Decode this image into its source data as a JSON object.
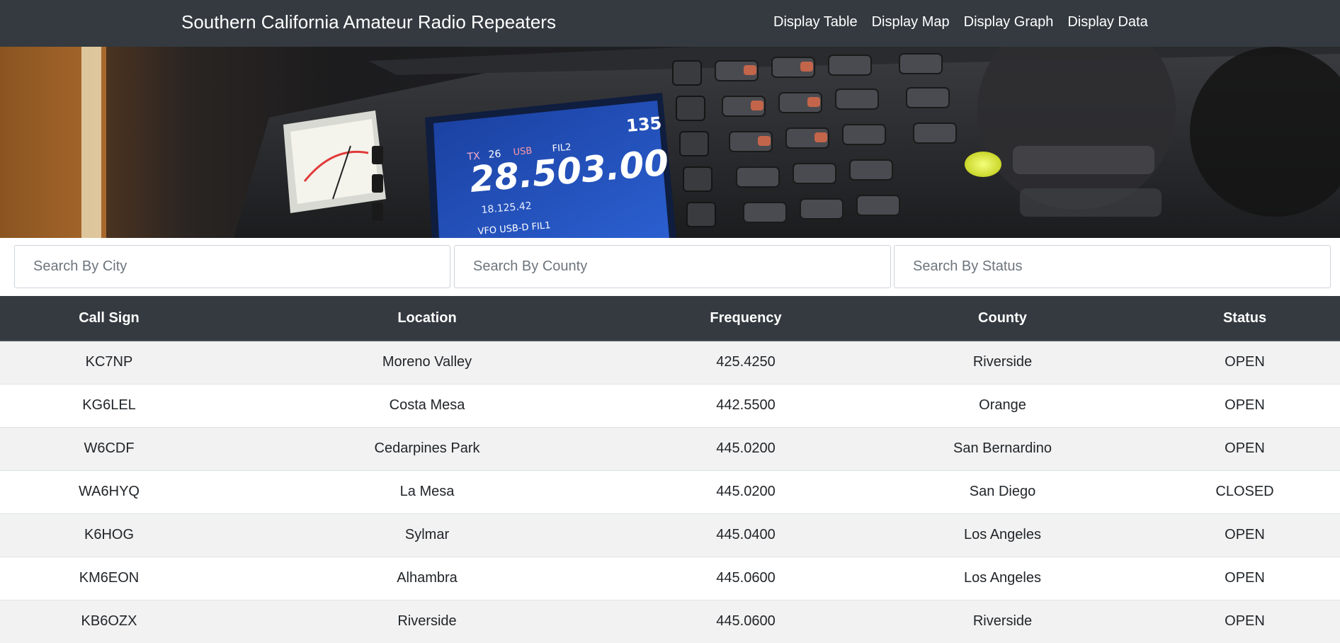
{
  "navbar": {
    "brand": "Southern California Amateur Radio Repeaters",
    "links": [
      "Display Table",
      "Display Map",
      "Display Graph",
      "Display Data"
    ]
  },
  "hero": {
    "description": "photo of amateur radio transceiver",
    "display_frequency": "28.503.00",
    "display_vfo": "18.125.42",
    "display_mode_left": "USB",
    "display_fil": "FIL2",
    "display_channel": "26",
    "display_tx": "TX",
    "display_bottom": "VFO  USB-D   FIL1",
    "display_right": "135"
  },
  "search": {
    "city_placeholder": "Search By City",
    "county_placeholder": "Search By County",
    "status_placeholder": "Search By Status"
  },
  "table": {
    "headers": [
      "Call Sign",
      "Location",
      "Frequency",
      "County",
      "Status"
    ],
    "rows": [
      [
        "KC7NP",
        "Moreno Valley",
        "425.4250",
        "Riverside",
        "OPEN"
      ],
      [
        "KG6LEL",
        "Costa Mesa",
        "442.5500",
        "Orange",
        "OPEN"
      ],
      [
        "W6CDF",
        "Cedarpines Park",
        "445.0200",
        "San Bernardino",
        "OPEN"
      ],
      [
        "WA6HYQ",
        "La Mesa",
        "445.0200",
        "San Diego",
        "CLOSED"
      ],
      [
        "K6HOG",
        "Sylmar",
        "445.0400",
        "Los Angeles",
        "OPEN"
      ],
      [
        "KM6EON",
        "Alhambra",
        "445.0600",
        "Los Angeles",
        "OPEN"
      ],
      [
        "KB6OZX",
        "Riverside",
        "445.0600",
        "Riverside",
        "OPEN"
      ]
    ]
  },
  "colors": {
    "navbar_bg": "#343a40",
    "table_header_bg": "#343a40",
    "stripe": "#f2f2f2"
  }
}
